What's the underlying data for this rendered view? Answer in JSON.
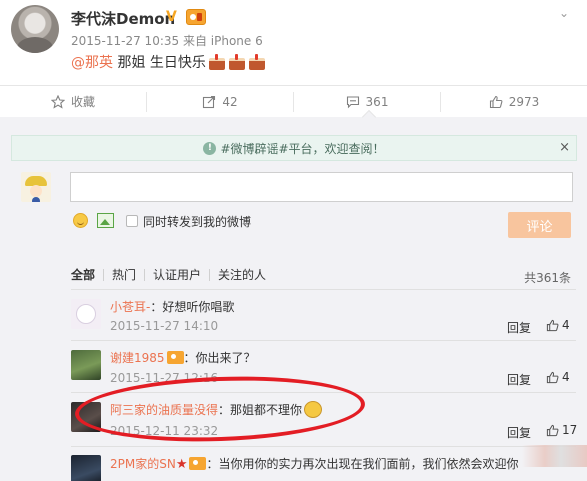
{
  "post": {
    "author": "李代沫Demon",
    "verified_mark": "V",
    "timestamp": "2015-11-27 10:35",
    "source": "来自 iPhone 6",
    "mention": "@那英",
    "text": " 那姐 生日快乐"
  },
  "actions": {
    "favorite": "收藏",
    "repost_count": "42",
    "comment_count": "361",
    "like_count": "2973"
  },
  "notice": {
    "text": "#微博辟谣#平台，欢迎查阅！",
    "close": "×"
  },
  "composer": {
    "input_value": "",
    "repost_label": "同时转发到我的微博",
    "submit_label": "评论"
  },
  "filters": [
    "全部",
    "热门",
    "认证用户",
    "关注的人"
  ],
  "total": "共361条",
  "comments": [
    {
      "name": "小苍耳-",
      "text": "：好想听你唱歌",
      "time": "2015-11-27 14:10",
      "reply": "回复",
      "likes": "4"
    },
    {
      "name": "谢建1985",
      "text": "：你出来了？",
      "time": "2015-11-27 12:16",
      "reply": "回复",
      "likes": "4"
    },
    {
      "name": "阿三家的油质量没得",
      "text": "：那姐都不理你",
      "time": "2015-12-11 23:32",
      "reply": "回复",
      "likes": "17"
    },
    {
      "name": "2PM家的SN",
      "text": "：当你用你的实力再次出现在我们面前，我们依然会欢迎你",
      "time": "",
      "reply": "",
      "likes": ""
    }
  ],
  "colors": {
    "accent": "#eb7350",
    "annotation": "#e31d24",
    "panel": "#f2f2f5"
  }
}
